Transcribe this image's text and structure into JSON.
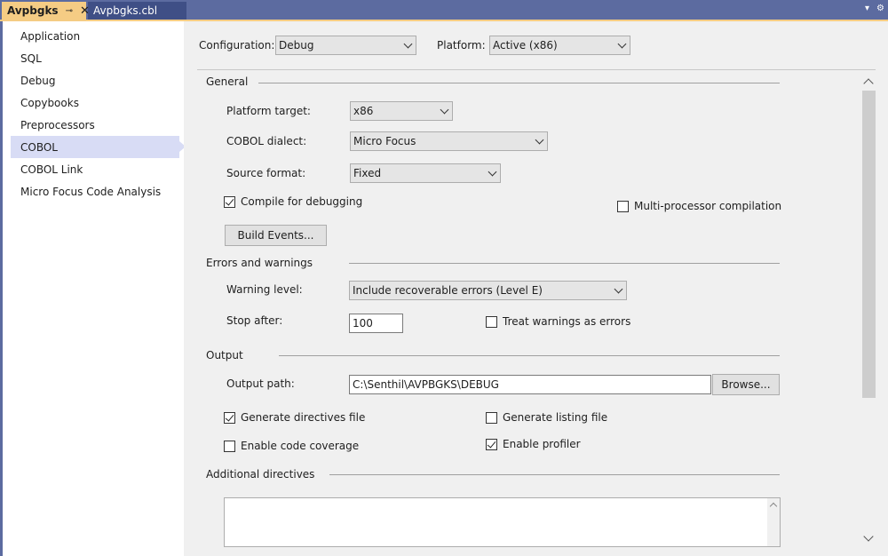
{
  "tabs": [
    {
      "label": "Avpbgks",
      "pin": "⊸",
      "close": "✕"
    },
    {
      "label": "Avpbgks.cbl"
    }
  ],
  "tabstrip_icons": {
    "dropdown": "▾",
    "settings": "⚙"
  },
  "sidebar": {
    "items": [
      {
        "label": "Application"
      },
      {
        "label": "SQL"
      },
      {
        "label": "Debug"
      },
      {
        "label": "Copybooks"
      },
      {
        "label": "Preprocessors"
      },
      {
        "label": "COBOL"
      },
      {
        "label": "COBOL Link"
      },
      {
        "label": "Micro Focus Code Analysis"
      }
    ],
    "selected_index": 5
  },
  "config": {
    "configuration_label": "Configuration:",
    "configuration_value": "Debug",
    "platform_label": "Platform:",
    "platform_value": "Active (x86)"
  },
  "general": {
    "title": "General",
    "platform_target_label": "Platform target:",
    "platform_target_value": "x86",
    "dialect_label": "COBOL dialect:",
    "dialect_value": "Micro Focus",
    "source_format_label": "Source format:",
    "source_format_value": "Fixed",
    "compile_debug_label": "Compile for debugging",
    "compile_debug_checked": true,
    "multiprocessor_label": "Multi-processor compilation",
    "multiprocessor_checked": false,
    "build_events_label": "Build Events..."
  },
  "errors": {
    "title": "Errors and warnings",
    "warning_level_label": "Warning level:",
    "warning_level_value": "Include recoverable errors (Level E)",
    "stop_after_label": "Stop after:",
    "stop_after_value": "100",
    "treat_warnings_label": "Treat warnings as errors",
    "treat_warnings_checked": false
  },
  "output": {
    "title": "Output",
    "output_path_label": "Output path:",
    "output_path_value": "C:\\Senthil\\AVPBGKS\\DEBUG",
    "browse_label": "Browse...",
    "gen_directives_label": "Generate directives file",
    "gen_directives_checked": true,
    "gen_listing_label": "Generate listing file",
    "gen_listing_checked": false,
    "code_coverage_label": "Enable code coverage",
    "code_coverage_checked": false,
    "profiler_label": "Enable profiler",
    "profiler_checked": true
  },
  "additional": {
    "title": "Additional directives"
  }
}
